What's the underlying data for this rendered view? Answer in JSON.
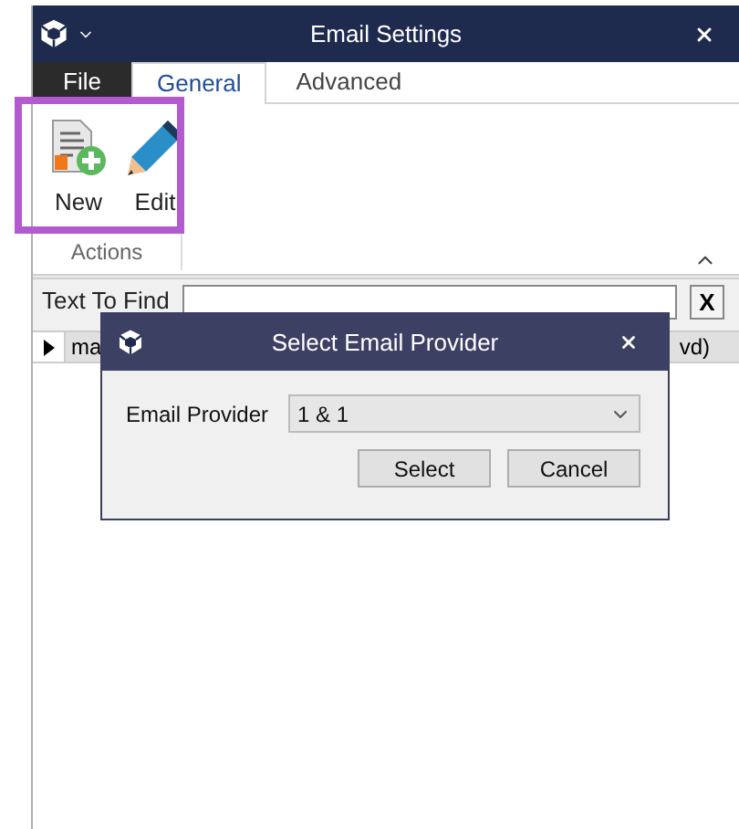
{
  "window": {
    "title": "Email Settings"
  },
  "ribbon": {
    "file_tab": "File",
    "tabs": [
      {
        "label": "General",
        "selected": true
      },
      {
        "label": "Advanced",
        "selected": false
      }
    ],
    "actions": [
      {
        "label": "New",
        "kind": "new"
      },
      {
        "label": "Edit",
        "kind": "edit"
      }
    ],
    "group_label": "Actions"
  },
  "search": {
    "label": "Text To Find",
    "clear": "X"
  },
  "grid": {
    "header_start": "ma",
    "header_end": "vd)"
  },
  "dialog": {
    "title": "Select Email Provider",
    "field_label": "Email Provider",
    "value": "1 & 1",
    "buttons": [
      "Select",
      "Cancel"
    ]
  }
}
